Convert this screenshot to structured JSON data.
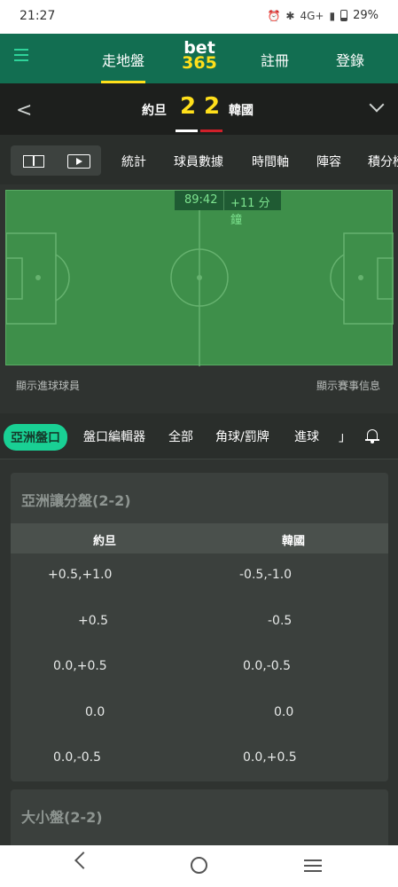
{
  "status": {
    "time": "21:27",
    "network": "4G+",
    "battery": "29%"
  },
  "header": {
    "nav_live": "走地盤",
    "logo_top": "bet",
    "logo_bottom": "365",
    "nav_register": "註冊",
    "nav_login": "登錄",
    "accent": "#126e51"
  },
  "match": {
    "home_team": "約旦",
    "away_team": "韓國",
    "home_score": "2",
    "away_score": "2",
    "home_kit_color": "#ffffff",
    "away_kit_color": "#d0202a"
  },
  "stat_tabs": [
    "統計",
    "球員數據",
    "時間軸",
    "陣容",
    "積分榜"
  ],
  "pitch": {
    "clock": "89:42",
    "added_time": "+11 分鐘",
    "show_scorers": "顯示進球球員",
    "show_info": "顯示賽事信息"
  },
  "market_tabs": {
    "active": "亞洲盤口",
    "items": [
      "盤口編輯器",
      "全部",
      "角球/罰牌",
      "進球",
      "」"
    ]
  },
  "asian_handicap": {
    "title": "亞洲讓分盤(2-2)",
    "col_home": "約旦",
    "col_away": "韓國",
    "rows": [
      {
        "home": "+0.5,+1.0",
        "away": "-0.5,-1.0"
      },
      {
        "home": "+0.5",
        "away": "-0.5"
      },
      {
        "home": "0.0,+0.5",
        "away": "0.0,-0.5"
      },
      {
        "home": "0.0",
        "away": "0.0"
      },
      {
        "home": "0.0,-0.5",
        "away": "0.0,+0.5"
      }
    ]
  },
  "totals": {
    "title": "大小盤(2-2)"
  }
}
